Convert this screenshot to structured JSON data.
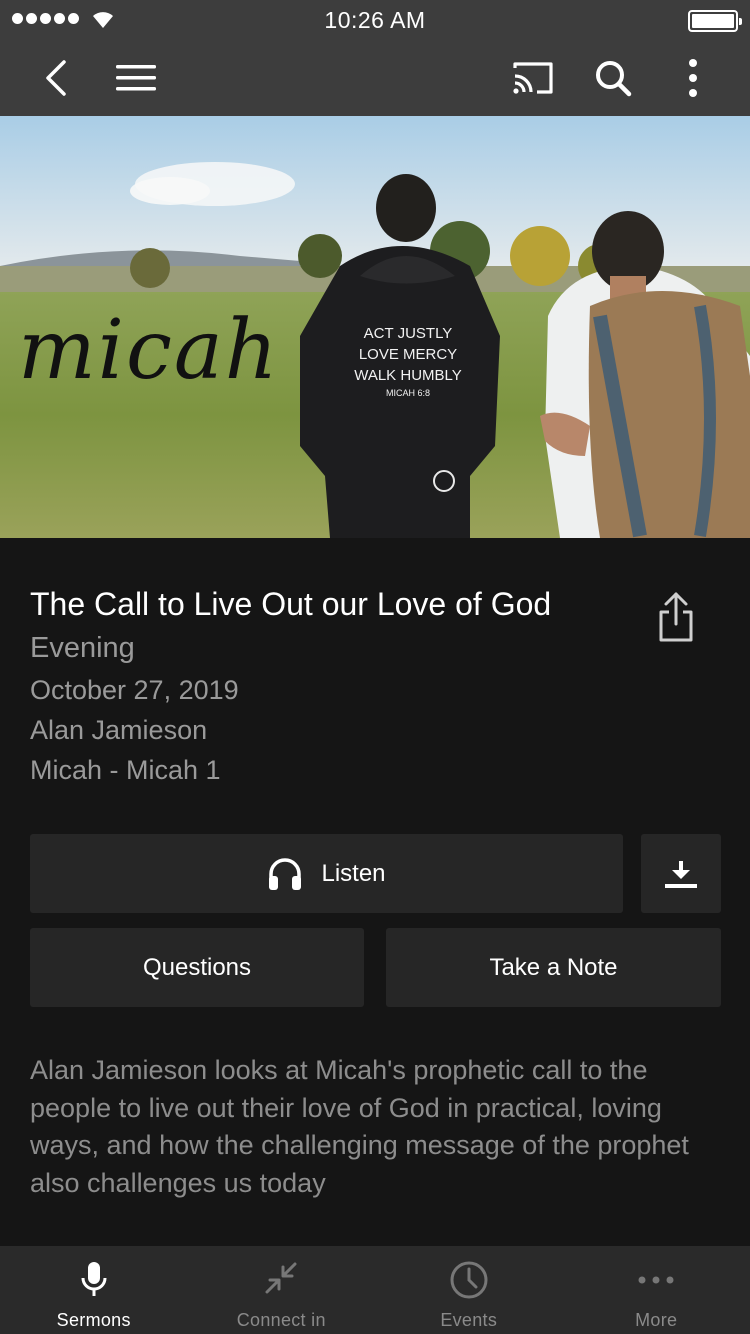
{
  "status_bar": {
    "time": "10:26 AM"
  },
  "nav": {
    "icons": [
      "back-icon",
      "menu-icon",
      "cast-icon",
      "search-icon",
      "more-vert-icon"
    ]
  },
  "hero": {
    "script_title": "micah",
    "hoodie_lines": [
      "ACT JUSTLY",
      "LOVE MERCY",
      "WALK HUMBLY",
      "MICAH 6:8"
    ]
  },
  "sermon": {
    "title": "The Call to Live Out our Love of God",
    "service": "Evening",
    "date": "October 27, 2019",
    "speaker": "Alan Jamieson",
    "passage": "Micah - Micah 1",
    "description": "Alan Jamieson looks at Micah's prophetic call to the people to live out their love of God in practical, loving ways, and how the challenging message of the prophet also challenges us today"
  },
  "actions": {
    "listen_label": "Listen",
    "questions_label": "Questions",
    "note_label": "Take a Note"
  },
  "tabs": [
    {
      "label": "Sermons",
      "icon": "microphone-icon",
      "active": true
    },
    {
      "label": "Connect in",
      "icon": "compress-arrows-icon",
      "active": false
    },
    {
      "label": "Events",
      "icon": "clock-icon",
      "active": false
    },
    {
      "label": "More",
      "icon": "dots-icon",
      "active": false
    }
  ],
  "colors": {
    "bar_background": "#3d3d3d",
    "page_background": "#151515",
    "button_background": "#262626",
    "muted_text": "#9a9a9a"
  }
}
